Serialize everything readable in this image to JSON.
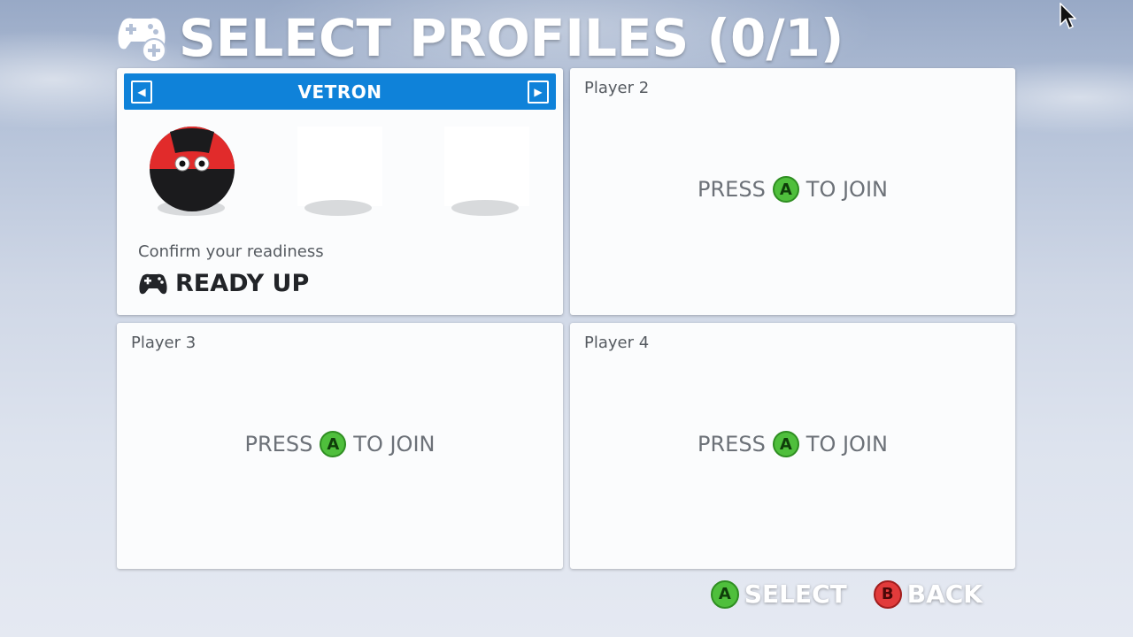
{
  "title": {
    "text": "SELECT PROFILES (0/1)",
    "icon": "gamepad-add-icon"
  },
  "player1": {
    "profile_name": "VETRON",
    "prev_icon": "arrow-left-icon",
    "next_icon": "arrow-right-icon",
    "avatar": "ladybug-ball-avatar",
    "confirm_text": "Confirm your readiness",
    "ready_label": "READY UP",
    "ready_icon": "gamepad-icon"
  },
  "slots": [
    {
      "label": "Player 2",
      "press": "PRESS",
      "button": "A",
      "join": "TO JOIN"
    },
    {
      "label": "Player 3",
      "press": "PRESS",
      "button": "A",
      "join": "TO JOIN"
    },
    {
      "label": "Player 4",
      "press": "PRESS",
      "button": "A",
      "join": "TO JOIN"
    }
  ],
  "footer": {
    "select_button": "A",
    "select_label": "SELECT",
    "back_button": "B",
    "back_label": "BACK"
  },
  "colors": {
    "profile_bar": "#0f82d9",
    "button_a": "#4fbf3c",
    "button_b": "#e23b3b",
    "panel": "#fbfcfd"
  }
}
